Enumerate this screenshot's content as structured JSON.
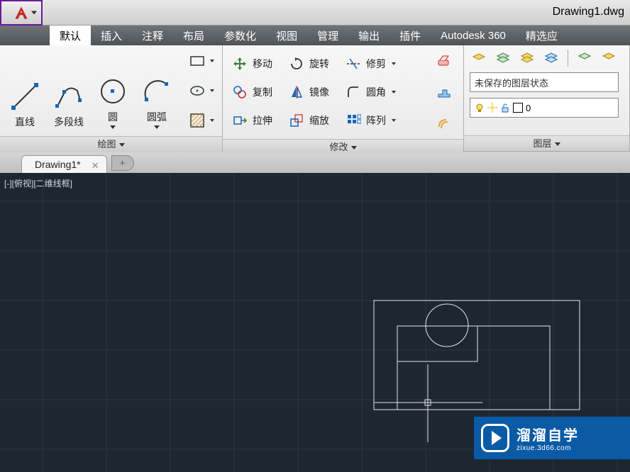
{
  "title": "Drawing1.dwg",
  "menu": {
    "items": [
      "默认",
      "插入",
      "注释",
      "布局",
      "参数化",
      "视图",
      "管理",
      "输出",
      "插件",
      "Autodesk 360",
      "精选应"
    ],
    "active_index": 0
  },
  "ribbon": {
    "draw_panel": {
      "title": "绘图",
      "line": "直线",
      "polyline": "多段线",
      "circle": "圆",
      "arc": "圆弧"
    },
    "modify_panel": {
      "title": "修改",
      "move": "移动",
      "copy": "复制",
      "stretch": "拉伸",
      "rotate": "旋转",
      "mirror": "镜像",
      "scale": "缩放",
      "trim": "修剪",
      "fillet": "圆角",
      "array": "阵列"
    },
    "layer_panel": {
      "title": "图层",
      "state_text": "未保存的图层状态",
      "current_layer": "0"
    }
  },
  "tabs": {
    "doc": "Drawing1*",
    "new_symbol": "+"
  },
  "viewport_label": "[-][俯视][二维线框]",
  "watermark": {
    "main": "溜溜自学",
    "sub": "zixue.3d66.com"
  },
  "chart_data": null
}
